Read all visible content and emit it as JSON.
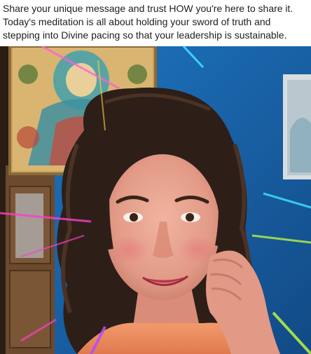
{
  "post": {
    "caption_lines": [
      "Share your unique message and trust HOW you're here to share it.",
      "Today's meditation is all about holding your sword of truth and",
      "stepping into Divine pacing so that your leadership is sustainable."
    ]
  },
  "media": {
    "subject": "woman with dark curly hair smiling, resting her chin on her hand",
    "background_colors": {
      "wall": "#1f6fb6",
      "wall_dark": "#144f8e",
      "door": "#6b4a2e",
      "tapestry": "#c9a35a",
      "light_streaks": [
        "#ff3ec8",
        "#3ee8ff",
        "#c6ff3e",
        "#b04dff"
      ]
    }
  }
}
